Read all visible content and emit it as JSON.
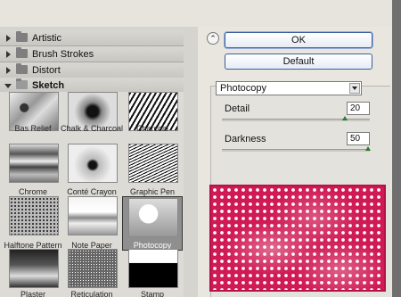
{
  "categories": [
    {
      "label": "Artistic",
      "expanded": false
    },
    {
      "label": "Brush Strokes",
      "expanded": false
    },
    {
      "label": "Distort",
      "expanded": false
    },
    {
      "label": "Sketch",
      "expanded": true
    }
  ],
  "thumbnails": [
    {
      "label": "Bas Relief",
      "selected": false
    },
    {
      "label": "Chalk & Charcoal",
      "selected": false
    },
    {
      "label": "Charcoal",
      "selected": false
    },
    {
      "label": "Chrome",
      "selected": false
    },
    {
      "label": "Conté Crayon",
      "selected": false
    },
    {
      "label": "Graphic Pen",
      "selected": false
    },
    {
      "label": "Halftone Pattern",
      "selected": false
    },
    {
      "label": "Note Paper",
      "selected": false
    },
    {
      "label": "Photocopy",
      "selected": true
    },
    {
      "label": "Plaster",
      "selected": false
    },
    {
      "label": "Reticulation",
      "selected": false
    },
    {
      "label": "Stamp",
      "selected": false
    }
  ],
  "buttons": {
    "ok": "OK",
    "default": "Default"
  },
  "filter_select": {
    "value": "Photocopy"
  },
  "params": {
    "detail": {
      "label": "Detail",
      "value": "20",
      "fraction": 0.83
    },
    "darkness": {
      "label": "Darkness",
      "value": "50",
      "fraction": 0.99
    }
  },
  "colors": {
    "preview_accent": "#d01a54",
    "button_border": "#3b5e9c",
    "slider_thumb": "#2f7b2f"
  },
  "icons": {
    "collapse": "double-chevron-up-icon"
  }
}
